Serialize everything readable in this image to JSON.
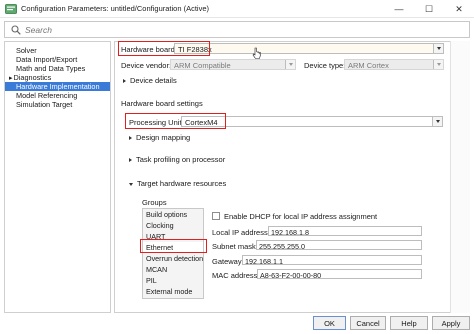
{
  "window": {
    "title": "Configuration Parameters: untitled/Configuration (Active)",
    "minimize_glyph": "—",
    "maximize_glyph": "☐",
    "close_glyph": "✕"
  },
  "search": {
    "placeholder": "Search",
    "value": ""
  },
  "nav": {
    "items": [
      {
        "label": "Solver",
        "expander": ""
      },
      {
        "label": "Data Import/Export",
        "expander": ""
      },
      {
        "label": "Math and Data Types",
        "expander": ""
      },
      {
        "label": "Diagnostics",
        "expander": "▸"
      },
      {
        "label": "Hardware Implementation",
        "expander": "",
        "selected": true
      },
      {
        "label": "Model Referencing",
        "expander": ""
      },
      {
        "label": "Simulation Target",
        "expander": ""
      }
    ]
  },
  "hardware": {
    "board_label": "Hardware board:",
    "board_value": "TI F2838x",
    "vendor_label": "Device vendor:",
    "vendor_value": "ARM Compatible",
    "type_label": "Device type:",
    "type_value": "ARM Cortex",
    "device_details": "Device details",
    "board_settings": "Hardware board settings",
    "processing_unit_label": "Processing Unit",
    "processing_unit_value": "CortexM4",
    "design_mapping": "Design mapping",
    "task_profiling": "Task profiling on processor",
    "target_resources": "Target hardware resources",
    "groups_label": "Groups"
  },
  "groups": [
    "Build options",
    "Clocking",
    "UART",
    "Ethernet",
    "Overrun detection",
    "MCAN",
    "PIL",
    "External mode"
  ],
  "ethernet": {
    "dhcp_label": "Enable DHCP for local IP address assignment",
    "dhcp_checked": false,
    "local_ip_label": "Local IP address:",
    "local_ip_value": "192.168.1.8",
    "subnet_label": "Subnet mask:",
    "subnet_value": "255.255.255.0",
    "gateway_label": "Gateway:",
    "gateway_value": "192.168.1.1",
    "mac_label": "MAC address:",
    "mac_value": "A8-63-F2-00-00-80"
  },
  "buttons": {
    "ok": "OK",
    "cancel": "Cancel",
    "help": "Help",
    "apply": "Apply"
  },
  "colors": {
    "selection": "#3b7bd8",
    "highlight_box": "#e0201e"
  },
  "icons": [
    "app-icon",
    "search-icon",
    "mouse-cursor-icon"
  ]
}
